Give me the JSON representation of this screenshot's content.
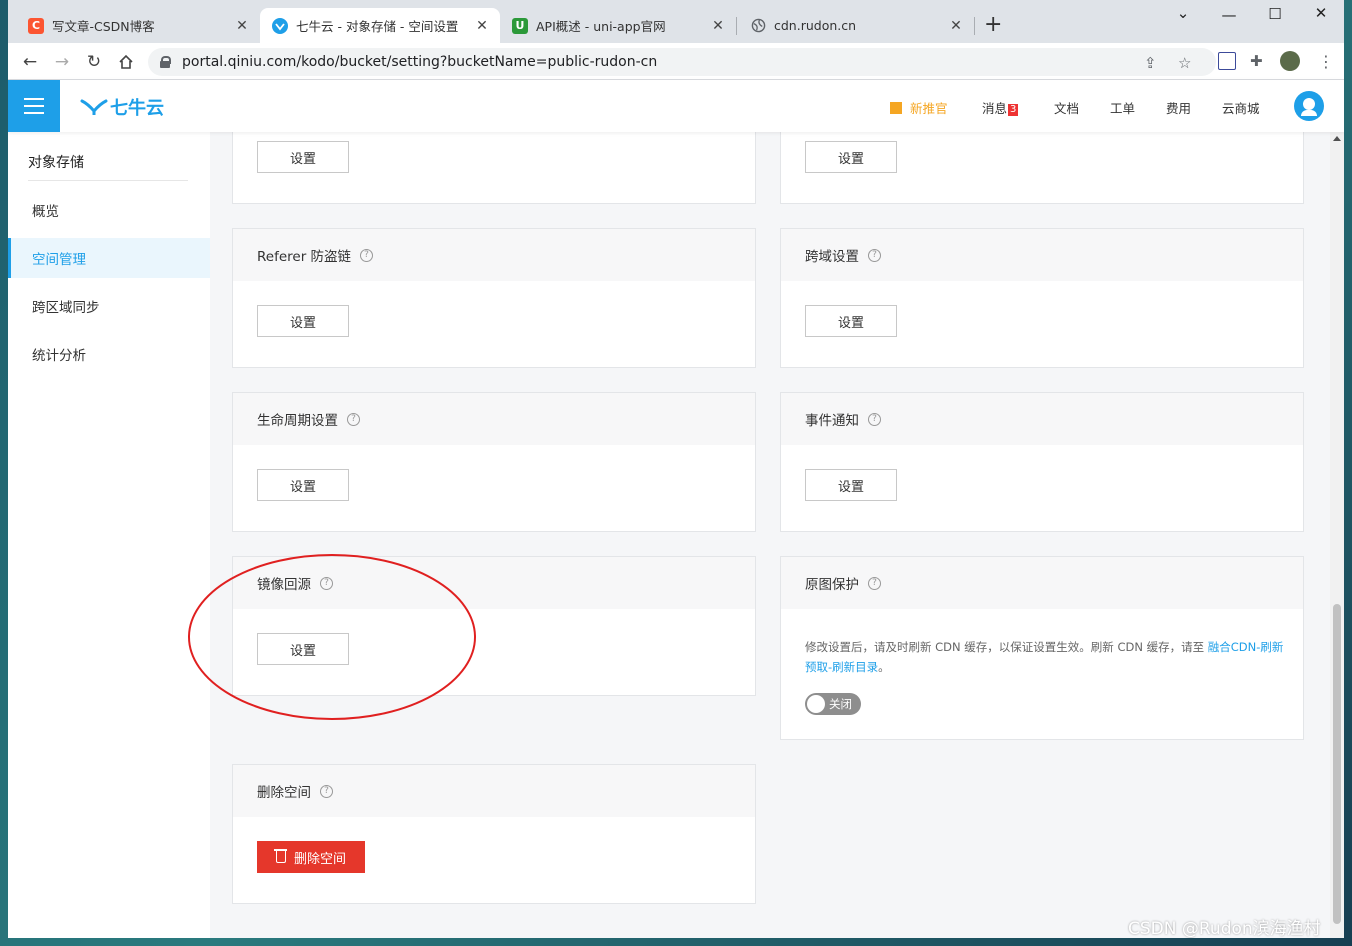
{
  "browser": {
    "tabs": [
      {
        "title": "写文章-CSDN博客",
        "icon": "csdn-icon",
        "icon_glyph": "C",
        "icon_color": "#fc5531"
      },
      {
        "title": "七牛云 - 对象存储 - 空间设置",
        "icon": "qiniu-icon",
        "icon_glyph": "",
        "icon_color": "#1e9fe8"
      },
      {
        "title": "API概述 - uni-app官网",
        "icon": "uniapp-icon",
        "icon_glyph": "U",
        "icon_color": "#2b9939"
      },
      {
        "title": "cdn.rudon.cn",
        "icon": "globe-icon",
        "icon_glyph": "",
        "icon_color": "#5f6368"
      }
    ],
    "new_tab": "+",
    "url": "portal.qiniu.com/kodo/bucket/setting?bucketName=public-rudon-cn"
  },
  "header": {
    "logo_text": "七牛云",
    "promo": "新推官",
    "messages": "消息",
    "messages_count": "3",
    "docs": "文档",
    "tickets": "工单",
    "billing": "费用",
    "market": "云商城"
  },
  "sidebar": {
    "title": "对象存储",
    "items": [
      {
        "label": "概览",
        "active": false
      },
      {
        "label": "空间管理",
        "active": true
      },
      {
        "label": "跨区域同步",
        "active": false
      },
      {
        "label": "统计分析",
        "active": false
      }
    ]
  },
  "cards": {
    "top_left_button": "设置",
    "top_right_button": "设置",
    "referer": {
      "title": "Referer 防盗链",
      "button": "设置"
    },
    "cors": {
      "title": "跨域设置",
      "button": "设置"
    },
    "lifecycle": {
      "title": "生命周期设置",
      "button": "设置"
    },
    "event": {
      "title": "事件通知",
      "button": "设置"
    },
    "mirror": {
      "title": "镜像回源",
      "button": "设置"
    },
    "original_protect": {
      "title": "原图保护",
      "desc_prefix": "修改设置后，请及时刷新 CDN 缓存，以保证设置生效。刷新 CDN 缓存，请至 ",
      "desc_link": "融合CDN-刷新预取-刷新目录",
      "desc_suffix": "。",
      "toggle_label": "关闭",
      "toggle_on": false
    },
    "delete": {
      "title": "删除空间",
      "button": "删除空间"
    }
  },
  "help_glyph": "?",
  "watermark": "CSDN @Rudon滨海渔村",
  "colors": {
    "brand": "#1e9fe8",
    "danger": "#e5372b",
    "annotation": "#e02020",
    "promo": "#f5a623"
  }
}
